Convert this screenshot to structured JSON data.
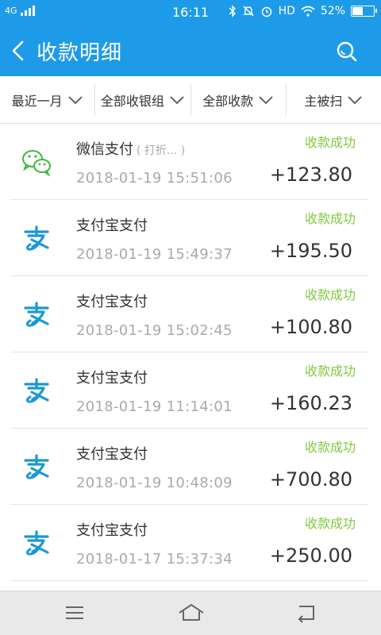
{
  "status_bar": {
    "network": "4G",
    "time": "16:11",
    "hd": "HD",
    "battery_text": "52%",
    "battery_level": 0.52
  },
  "header": {
    "title": "收款明细"
  },
  "filters": [
    {
      "label": "最近一月"
    },
    {
      "label": "全部收银组"
    },
    {
      "label": "全部收款"
    },
    {
      "label": "主被扫"
    }
  ],
  "transactions": [
    {
      "method": "微信支付",
      "note": "( 打折... )",
      "date": "2018-01-19 15:51:06",
      "status": "收款成功",
      "amount": "+123.80",
      "icon": "wechat-pay-icon"
    },
    {
      "method": "支付宝支付",
      "note": "",
      "date": "2018-01-19 15:49:37",
      "status": "收款成功",
      "amount": "+195.50",
      "icon": "alipay-icon"
    },
    {
      "method": "支付宝支付",
      "note": "",
      "date": "2018-01-19 15:02:45",
      "status": "收款成功",
      "amount": "+100.80",
      "icon": "alipay-icon"
    },
    {
      "method": "支付宝支付",
      "note": "",
      "date": "2018-01-19 11:14:01",
      "status": "收款成功",
      "amount": "+160.23",
      "icon": "alipay-icon"
    },
    {
      "method": "支付宝支付",
      "note": "",
      "date": "2018-01-19 10:48:09",
      "status": "收款成功",
      "amount": "+700.80",
      "icon": "alipay-icon"
    },
    {
      "method": "支付宝支付",
      "note": "",
      "date": "2018-01-17 15:37:34",
      "status": "收款成功",
      "amount": "+250.00",
      "icon": "alipay-icon"
    }
  ],
  "colors": {
    "primary": "#1e9be8",
    "success": "#7fca3f",
    "wechat": "#3fb63f",
    "alipay": "#1a98d5"
  }
}
